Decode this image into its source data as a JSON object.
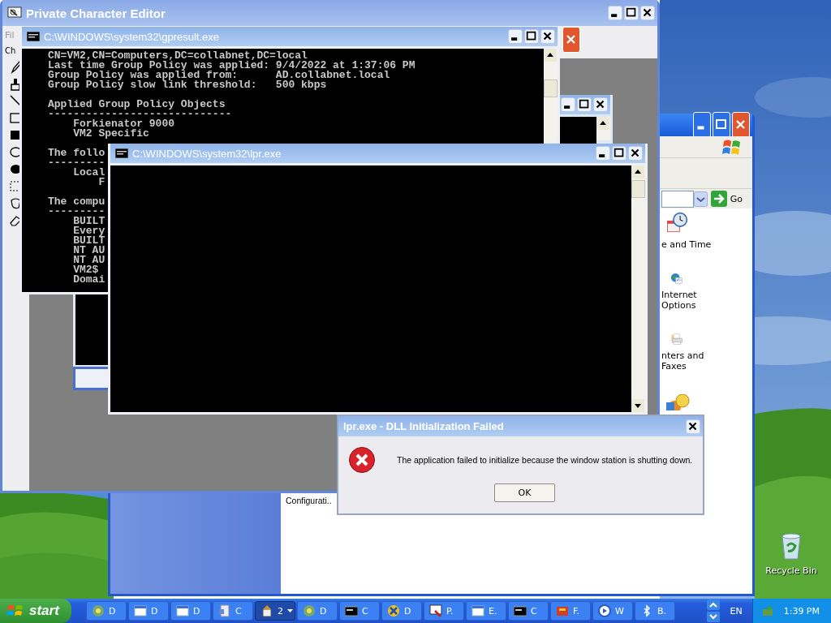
{
  "desktop": {
    "icons": [
      {
        "label": "Recycle Bin"
      }
    ]
  },
  "control_panel": {
    "address_button": "Go",
    "items": [
      {
        "lines": [
          "e and Time"
        ]
      },
      {
        "lines": [
          "Internet",
          "Options"
        ]
      },
      {
        "lines": [
          "nters and",
          "Faxes"
        ]
      }
    ],
    "content_label": "Configurati.."
  },
  "private_character_editor": {
    "title": "Private Character Editor",
    "menu": [
      "Fil"
    ],
    "row_label": "Ch"
  },
  "gpresult": {
    "title": "C:\\WINDOWS\\system32\\gpresult.exe",
    "blocks": [
      [
        "CN=VM2,CN=Computers,DC=collabnet,DC=local",
        "Last time Group Policy was applied: 9/4/2022 at 1:37:06 PM",
        "Group Policy was applied from:      AD.collabnet.local",
        "Group Policy slow link threshold:   500 kbps"
      ],
      [
        "Applied Group Policy Objects",
        "-----------------------------",
        "    Forkienator 9000",
        "    VM2 Specific"
      ],
      [
        "The follo",
        "---------",
        "    Local",
        "        F"
      ],
      [
        "The compu",
        "---------",
        "    BUILT",
        "    Every",
        "    BUILT",
        "    NT AU",
        "    NT AU",
        "    VM2$",
        "    Domai"
      ]
    ]
  },
  "lpr": {
    "title": "C:\\WINDOWS\\system32\\lpr.exe"
  },
  "dialog": {
    "title": "lpr.exe - DLL Initialization Failed",
    "message": "The application failed to initialize because the window station is shutting down.",
    "button": "OK"
  },
  "taskbar": {
    "start": "start",
    "buttons": [
      {
        "label": "D",
        "selected": false,
        "kind": "window"
      },
      {
        "label": "D",
        "selected": false,
        "kind": "window"
      },
      {
        "label": "D",
        "selected": false,
        "kind": "window"
      },
      {
        "label": "C",
        "selected": false,
        "kind": "window"
      },
      {
        "label": "2",
        "selected": true,
        "kind": "group"
      },
      {
        "label": "D",
        "selected": false,
        "kind": "window"
      },
      {
        "label": "C",
        "selected": false,
        "kind": "window"
      },
      {
        "label": "D",
        "selected": false,
        "kind": "window"
      },
      {
        "label": "P.",
        "selected": false,
        "kind": "window"
      },
      {
        "label": "E.",
        "selected": false,
        "kind": "window"
      },
      {
        "label": "C",
        "selected": false,
        "kind": "window"
      },
      {
        "label": "F.",
        "selected": false,
        "kind": "window"
      },
      {
        "label": "W",
        "selected": false,
        "kind": "window"
      },
      {
        "label": "B.",
        "selected": false,
        "kind": "window"
      }
    ],
    "language": "EN",
    "clock": "1:39 PM"
  }
}
